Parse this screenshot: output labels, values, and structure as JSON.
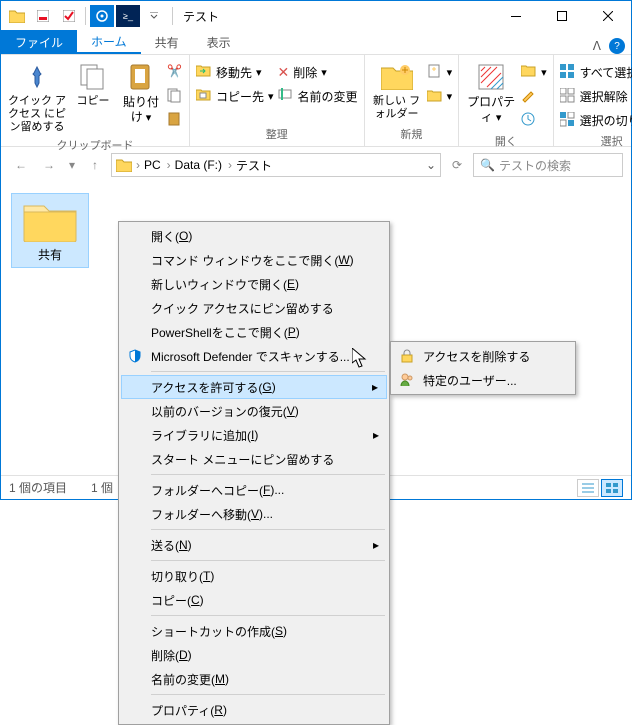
{
  "titlebar": {
    "title": "テスト"
  },
  "tabs": {
    "file": "ファイル",
    "home": "ホーム",
    "share": "共有",
    "view": "表示"
  },
  "ribbon": {
    "clipboard": {
      "label": "クリップボード",
      "pin": "クイック アクセス\nにピン留めする",
      "copy": "コピー",
      "paste": "貼り付け"
    },
    "organize": {
      "label": "整理",
      "move": "移動先",
      "copyto": "コピー先",
      "delete": "削除",
      "rename": "名前の変更"
    },
    "new": {
      "label": "新規",
      "newfolder": "新しい\nフォルダー"
    },
    "open": {
      "label": "開く",
      "properties": "プロパティ"
    },
    "select": {
      "label": "選択",
      "all": "すべて選択",
      "none": "選択解除",
      "invert": "選択の切り替え"
    }
  },
  "breadcrumb": {
    "pc": "PC",
    "drive": "Data (F:)",
    "folder": "テスト"
  },
  "search": {
    "placeholder": "テストの検索"
  },
  "folder": {
    "name": "共有"
  },
  "status": {
    "count": "1 個の項目",
    "sel": "1 個"
  },
  "menu": {
    "open": "開く(",
    "open_k": "O",
    "cmd": "コマンド ウィンドウをここで開く(",
    "cmd_k": "W",
    "newwin": "新しいウィンドウで開く(",
    "newwin_k": "E",
    "pin": "クイック アクセスにピン留めする",
    "ps": "PowerShellをここで開く(",
    "ps_k": "P",
    "defender": "Microsoft Defender でスキャンする...",
    "access": "アクセスを許可する(",
    "access_k": "G",
    "restore": "以前のバージョンの復元(",
    "restore_k": "V",
    "library": "ライブラリに追加(",
    "library_k": "I",
    "startpin": "スタート メニューにピン留めする",
    "copyto2": "フォルダーへコピー(",
    "copyto2_k": "F",
    "moveto2": "フォルダーへ移動(",
    "moveto2_k": "V",
    "send": "送る(",
    "send_k": "N",
    "cut": "切り取り(",
    "cut_k": "T",
    "copy2": "コピー(",
    "copy2_k": "C",
    "shortcut": "ショートカットの作成(",
    "shortcut_k": "S",
    "del": "削除(",
    "del_k": "D",
    "ren": "名前の変更(",
    "ren_k": "M",
    "prop": "プロパティ(",
    "prop_k": "R"
  },
  "submenu": {
    "remove": "アクセスを削除する",
    "user": "特定のユーザー..."
  }
}
